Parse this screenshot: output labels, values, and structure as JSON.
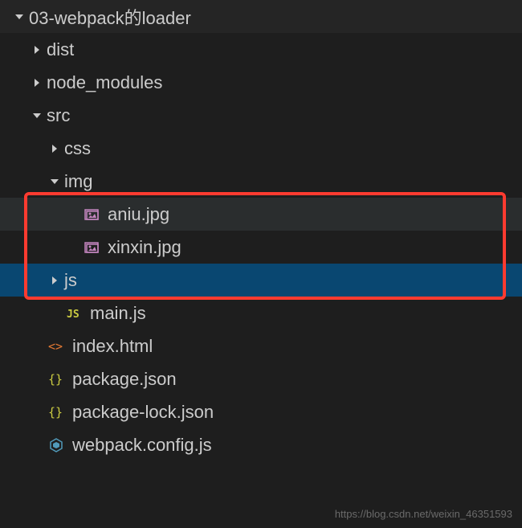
{
  "tree": {
    "root": {
      "label": "03-webpack的loader",
      "items": [
        {
          "label": "dist"
        },
        {
          "label": "node_modules"
        },
        {
          "label": "src",
          "items": [
            {
              "label": "css"
            },
            {
              "label": "img",
              "items": [
                {
                  "label": "aniu.jpg"
                },
                {
                  "label": "xinxin.jpg"
                }
              ]
            },
            {
              "label": "js"
            },
            {
              "label": "main.js"
            }
          ]
        },
        {
          "label": "index.html"
        },
        {
          "label": "package.json"
        },
        {
          "label": "package-lock.json"
        },
        {
          "label": "webpack.config.js"
        }
      ]
    }
  },
  "watermark": "https://blog.csdn.net/weixin_46351593"
}
